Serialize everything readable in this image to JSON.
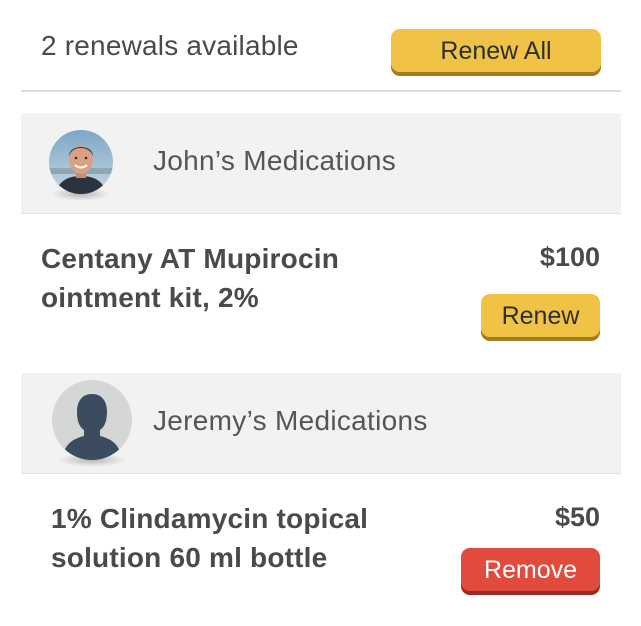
{
  "summary": {
    "renewals_text": "2 renewals available",
    "renew_all_label": "Renew All"
  },
  "patients": [
    {
      "title": "John’s Medications",
      "avatar": "john-photo-avatar",
      "medication": {
        "name_line1": "Centany AT Mupirocin",
        "name_line2": "ointment kit, 2%",
        "price": "$100",
        "action_label": "Renew"
      }
    },
    {
      "title": "Jeremy’s Medications",
      "avatar": "default-person-avatar",
      "medication": {
        "name_line1": "1% Clindamycin topical",
        "name_line2": "solution 60 ml bottle",
        "price": "$50",
        "action_label": "Remove"
      }
    }
  ],
  "colors": {
    "renew_button": "#f0c245",
    "remove_button": "#e04b3d",
    "section_bg": "#f2f2f1",
    "text": "#4a4a4a"
  }
}
